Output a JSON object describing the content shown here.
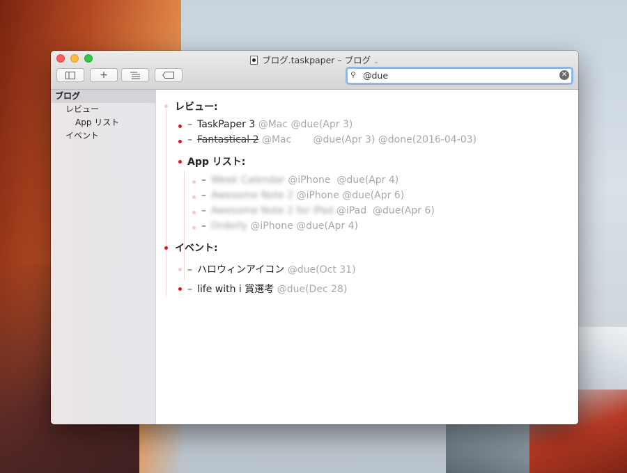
{
  "window": {
    "title": "ブログ.taskpaper – ブログ",
    "title_chevron": "⌄"
  },
  "toolbar": {
    "sidebar_icon": "sidebar-icon",
    "add_icon": "plus-icon",
    "add_label": "+",
    "outline_icon": "outline-icon",
    "tag_icon": "tag-icon"
  },
  "search": {
    "value": "@due",
    "icon": "search-icon",
    "clear_icon": "clear-icon"
  },
  "sidebar": {
    "items": [
      {
        "label": "ブログ",
        "selected": true
      },
      {
        "label": "レビュー"
      },
      {
        "label": "App リスト"
      },
      {
        "label": "イベント"
      }
    ]
  },
  "document": {
    "project_review": "レビュー:",
    "task1_dash": "–",
    "task1_text": "TaskPaper 3",
    "task1_tags": "@Mac @due(Apr 3)",
    "task2_text": "Fantastical 2",
    "task2_tags": "@Mac       @due(Apr 3) @done(2016-04-03)",
    "project_apps": "App リスト:",
    "app1_text": "Week Calendar",
    "app1_tags": "@iPhone  @due(Apr 4)",
    "app2_text": "Awesome Note 2",
    "app2_tags": " @iPhone @due(Apr 6)",
    "app3_text": "Awesome Note 2 for iPad",
    "app3_tags": "@iPad  @due(Apr 6)",
    "app4_text": "Orderly",
    "app4_tags": "@iPhone @due(Apr 4)",
    "project_events": "イベント:",
    "event1_text": "ハロウィンアイコン",
    "event1_tags": "@due(Oct 31)",
    "event2_text": "life with i 賞選考",
    "event2_tags": "@due(Dec 28)",
    "dash": "–"
  },
  "colors": {
    "bullet_active": "#d7141a",
    "bullet_inactive": "#f2c9c9",
    "tag_gray": "#a8a8a8",
    "search_focus": "#8fb5e6"
  }
}
